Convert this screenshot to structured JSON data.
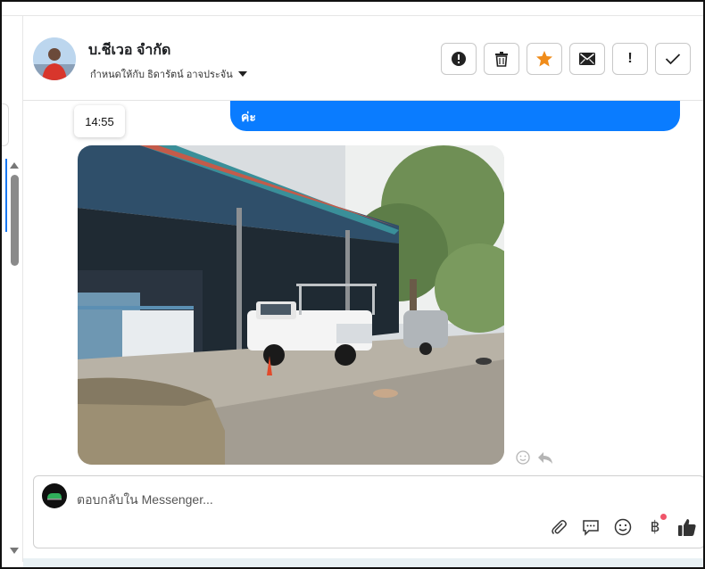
{
  "header": {
    "name": "บ.ชีเวอ จำกัด",
    "assigned_to": "กำหนดให้กับ ธิดารัตน์ อาจประจัน",
    "actions": [
      {
        "icon": "alert-circle-icon"
      },
      {
        "icon": "trash-icon"
      },
      {
        "icon": "star-icon",
        "color": "#f08c1a"
      },
      {
        "icon": "envelope-icon"
      },
      {
        "icon": "exclamation-icon",
        "label": "!"
      },
      {
        "icon": "check-icon"
      }
    ]
  },
  "chat": {
    "outgoing_bubble_text": "ค่ะ",
    "bubble_color": "#0a7cff",
    "timestamp": "14:55",
    "image_icon": "photo-garage-trucks",
    "reaction_icons": [
      "smiley-icon",
      "reply-icon"
    ]
  },
  "composer": {
    "placeholder": "ตอบกลับใน Messenger...",
    "tools": [
      "paperclip-icon",
      "saved-replies-icon",
      "emoji-icon",
      "baht-icon",
      "thumbs-up-icon"
    ],
    "baht_symbol": "฿",
    "notification_color": "#f0556a"
  }
}
